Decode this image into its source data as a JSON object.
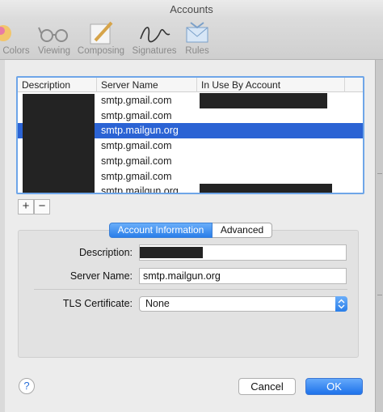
{
  "window": {
    "title": "Accounts"
  },
  "toolbar": {
    "items": [
      {
        "label": "Colors"
      },
      {
        "label": "Viewing"
      },
      {
        "label": "Composing"
      },
      {
        "label": "Signatures"
      },
      {
        "label": "Rules"
      }
    ]
  },
  "table": {
    "headers": [
      "Description",
      "Server Name",
      "In Use By Account"
    ],
    "rows": [
      {
        "server": "smtp.gmail.com"
      },
      {
        "server": "smtp.gmail.com"
      },
      {
        "server": "smtp.mailgun.org"
      },
      {
        "server": "smtp.gmail.com"
      },
      {
        "server": "smtp.gmail.com"
      },
      {
        "server": "smtp.gmail.com"
      },
      {
        "server": "smtp.mailgun.org"
      }
    ],
    "selected_index": 2
  },
  "list_controls": {
    "add": "+",
    "remove": "−"
  },
  "tabs": {
    "account_information": "Account Information",
    "advanced": "Advanced"
  },
  "form": {
    "description_label": "Description:",
    "server_name_label": "Server Name:",
    "server_name_value": "smtp.mailgun.org",
    "tls_label": "TLS Certificate:",
    "tls_value": "None"
  },
  "footer": {
    "help": "?",
    "cancel": "Cancel",
    "ok": "OK"
  },
  "colors": {
    "selection": "#2b63d4",
    "accent": "#2a7ee9",
    "focus_ring": "#6ea5e8"
  }
}
